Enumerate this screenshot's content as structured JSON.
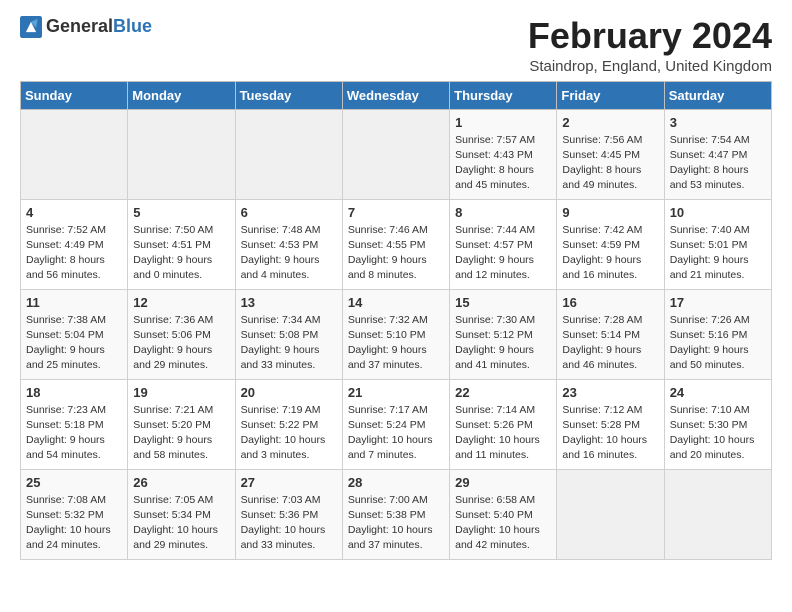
{
  "header": {
    "logo_general": "General",
    "logo_blue": "Blue",
    "month_title": "February 2024",
    "location": "Staindrop, England, United Kingdom"
  },
  "days_of_week": [
    "Sunday",
    "Monday",
    "Tuesday",
    "Wednesday",
    "Thursday",
    "Friday",
    "Saturday"
  ],
  "weeks": [
    [
      {
        "num": "",
        "info": ""
      },
      {
        "num": "",
        "info": ""
      },
      {
        "num": "",
        "info": ""
      },
      {
        "num": "",
        "info": ""
      },
      {
        "num": "1",
        "info": "Sunrise: 7:57 AM\nSunset: 4:43 PM\nDaylight: 8 hours\nand 45 minutes."
      },
      {
        "num": "2",
        "info": "Sunrise: 7:56 AM\nSunset: 4:45 PM\nDaylight: 8 hours\nand 49 minutes."
      },
      {
        "num": "3",
        "info": "Sunrise: 7:54 AM\nSunset: 4:47 PM\nDaylight: 8 hours\nand 53 minutes."
      }
    ],
    [
      {
        "num": "4",
        "info": "Sunrise: 7:52 AM\nSunset: 4:49 PM\nDaylight: 8 hours\nand 56 minutes."
      },
      {
        "num": "5",
        "info": "Sunrise: 7:50 AM\nSunset: 4:51 PM\nDaylight: 9 hours\nand 0 minutes."
      },
      {
        "num": "6",
        "info": "Sunrise: 7:48 AM\nSunset: 4:53 PM\nDaylight: 9 hours\nand 4 minutes."
      },
      {
        "num": "7",
        "info": "Sunrise: 7:46 AM\nSunset: 4:55 PM\nDaylight: 9 hours\nand 8 minutes."
      },
      {
        "num": "8",
        "info": "Sunrise: 7:44 AM\nSunset: 4:57 PM\nDaylight: 9 hours\nand 12 minutes."
      },
      {
        "num": "9",
        "info": "Sunrise: 7:42 AM\nSunset: 4:59 PM\nDaylight: 9 hours\nand 16 minutes."
      },
      {
        "num": "10",
        "info": "Sunrise: 7:40 AM\nSunset: 5:01 PM\nDaylight: 9 hours\nand 21 minutes."
      }
    ],
    [
      {
        "num": "11",
        "info": "Sunrise: 7:38 AM\nSunset: 5:04 PM\nDaylight: 9 hours\nand 25 minutes."
      },
      {
        "num": "12",
        "info": "Sunrise: 7:36 AM\nSunset: 5:06 PM\nDaylight: 9 hours\nand 29 minutes."
      },
      {
        "num": "13",
        "info": "Sunrise: 7:34 AM\nSunset: 5:08 PM\nDaylight: 9 hours\nand 33 minutes."
      },
      {
        "num": "14",
        "info": "Sunrise: 7:32 AM\nSunset: 5:10 PM\nDaylight: 9 hours\nand 37 minutes."
      },
      {
        "num": "15",
        "info": "Sunrise: 7:30 AM\nSunset: 5:12 PM\nDaylight: 9 hours\nand 41 minutes."
      },
      {
        "num": "16",
        "info": "Sunrise: 7:28 AM\nSunset: 5:14 PM\nDaylight: 9 hours\nand 46 minutes."
      },
      {
        "num": "17",
        "info": "Sunrise: 7:26 AM\nSunset: 5:16 PM\nDaylight: 9 hours\nand 50 minutes."
      }
    ],
    [
      {
        "num": "18",
        "info": "Sunrise: 7:23 AM\nSunset: 5:18 PM\nDaylight: 9 hours\nand 54 minutes."
      },
      {
        "num": "19",
        "info": "Sunrise: 7:21 AM\nSunset: 5:20 PM\nDaylight: 9 hours\nand 58 minutes."
      },
      {
        "num": "20",
        "info": "Sunrise: 7:19 AM\nSunset: 5:22 PM\nDaylight: 10 hours\nand 3 minutes."
      },
      {
        "num": "21",
        "info": "Sunrise: 7:17 AM\nSunset: 5:24 PM\nDaylight: 10 hours\nand 7 minutes."
      },
      {
        "num": "22",
        "info": "Sunrise: 7:14 AM\nSunset: 5:26 PM\nDaylight: 10 hours\nand 11 minutes."
      },
      {
        "num": "23",
        "info": "Sunrise: 7:12 AM\nSunset: 5:28 PM\nDaylight: 10 hours\nand 16 minutes."
      },
      {
        "num": "24",
        "info": "Sunrise: 7:10 AM\nSunset: 5:30 PM\nDaylight: 10 hours\nand 20 minutes."
      }
    ],
    [
      {
        "num": "25",
        "info": "Sunrise: 7:08 AM\nSunset: 5:32 PM\nDaylight: 10 hours\nand 24 minutes."
      },
      {
        "num": "26",
        "info": "Sunrise: 7:05 AM\nSunset: 5:34 PM\nDaylight: 10 hours\nand 29 minutes."
      },
      {
        "num": "27",
        "info": "Sunrise: 7:03 AM\nSunset: 5:36 PM\nDaylight: 10 hours\nand 33 minutes."
      },
      {
        "num": "28",
        "info": "Sunrise: 7:00 AM\nSunset: 5:38 PM\nDaylight: 10 hours\nand 37 minutes."
      },
      {
        "num": "29",
        "info": "Sunrise: 6:58 AM\nSunset: 5:40 PM\nDaylight: 10 hours\nand 42 minutes."
      },
      {
        "num": "",
        "info": ""
      },
      {
        "num": "",
        "info": ""
      }
    ]
  ]
}
